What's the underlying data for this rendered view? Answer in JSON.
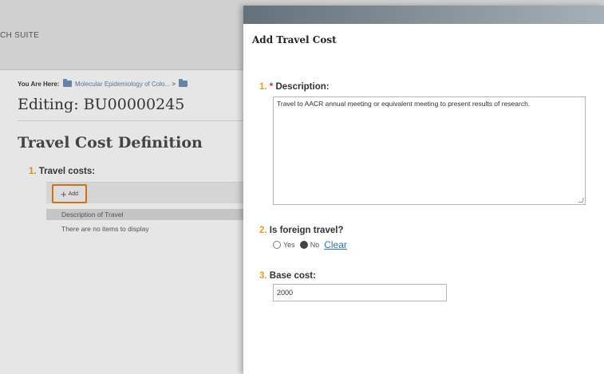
{
  "app": {
    "suite_label": "CH SUITE"
  },
  "breadcrumb": {
    "prefix": "You Are Here:",
    "item": "Molecular Epidemiology of Colo...",
    "separator": ">"
  },
  "page": {
    "editing_title": "Editing: BU00000245",
    "section_title": "Travel Cost Definition"
  },
  "travel_costs": {
    "number": "1.",
    "label": "Travel costs:",
    "add_label": "Add",
    "column_header": "Description of Travel",
    "empty_text": "There are no items to display"
  },
  "dialog": {
    "title": "Add Travel Cost",
    "description": {
      "number": "1.",
      "required_mark": "*",
      "label": "Description:",
      "value": "Travel to AACR annual meeting or equivalent meeting to present results of research."
    },
    "foreign_travel": {
      "number": "2.",
      "label": "Is foreign travel?",
      "options": [
        "Yes",
        "No"
      ],
      "selected": "No",
      "clear_label": "Clear"
    },
    "base_cost": {
      "number": "3.",
      "label": "Base cost:",
      "value": "2000"
    }
  },
  "colors": {
    "question_number": "#e69a1f",
    "add_highlight": "#e07b17",
    "link": "#2d72b8",
    "required": "#c0392b"
  },
  "icons": [
    "folder-icon",
    "plus-icon",
    "radio-unselected-icon",
    "radio-selected-icon",
    "resize-grip-icon"
  ]
}
